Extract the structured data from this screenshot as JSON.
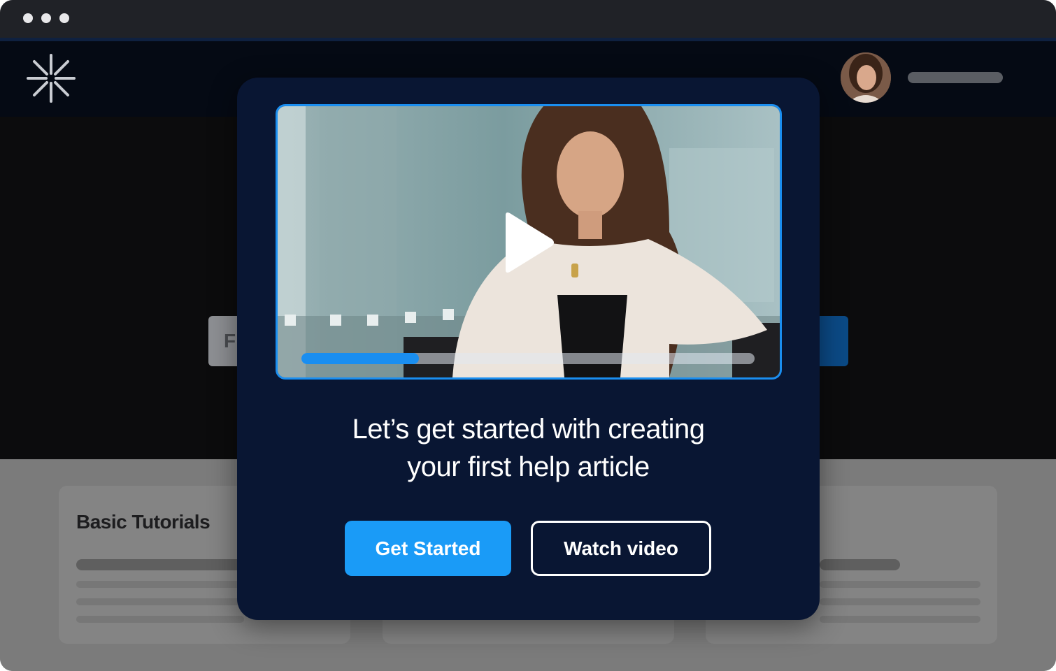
{
  "window": {
    "controls": [
      "dot",
      "dot",
      "dot"
    ]
  },
  "search": {
    "value_partial": "F"
  },
  "modal": {
    "heading_line1": "Let’s get started with creating",
    "heading_line2": "your first help article",
    "primary_label": "Get Started",
    "secondary_label": "Watch video",
    "video": {
      "progress": 0.26,
      "play_icon": "play-icon"
    }
  },
  "cards": [
    {
      "title": "Basic Tutorials"
    },
    {
      "title": ""
    },
    {
      "title": ""
    }
  ],
  "colors": {
    "accent": "#1a9bf7",
    "modal_bg": "#091633",
    "header_bg": "#050a14"
  }
}
